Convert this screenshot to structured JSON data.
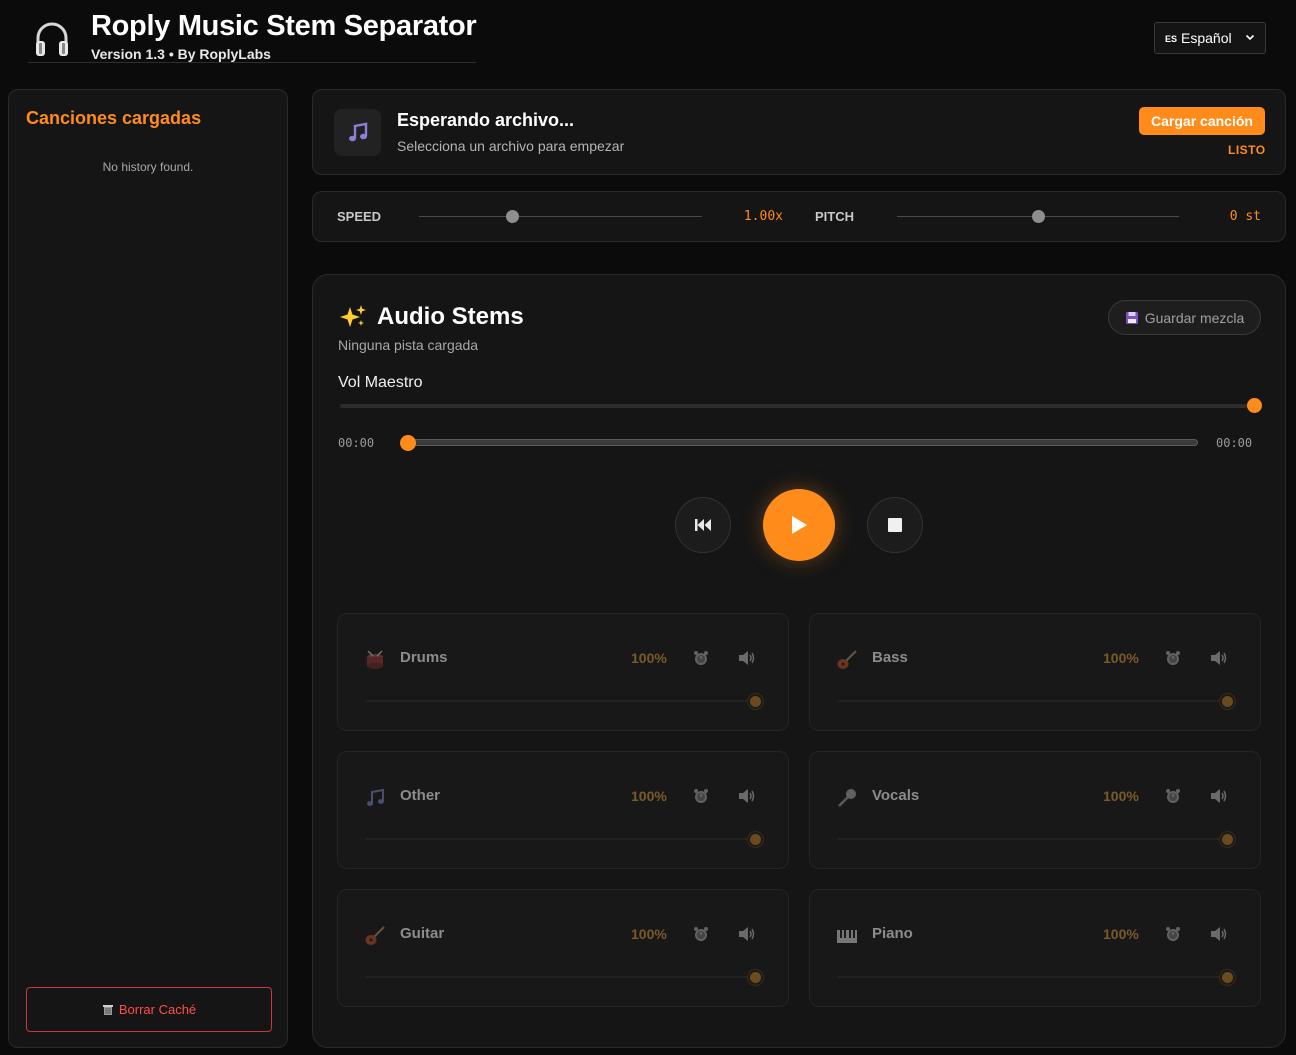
{
  "header": {
    "title": "Roply Music Stem Separator",
    "subtitle": "Version 1.3 • By RoplyLabs",
    "language": {
      "flag": "ES",
      "selected": "Español"
    }
  },
  "sidebar": {
    "title": "Canciones cargadas",
    "empty_text": "No history found.",
    "clear_cache_label": "Borrar Caché"
  },
  "loader": {
    "title": "Esperando archivo...",
    "subtitle": "Selecciona un archivo para empezar",
    "load_button": "Cargar canción",
    "status": "LISTO"
  },
  "controls": {
    "speed_label": "SPEED",
    "speed_value": "1.00x",
    "speed_level": 0.33,
    "pitch_label": "PITCH",
    "pitch_value": "0 st",
    "pitch_level": 0.5
  },
  "stems_panel": {
    "title": "Audio Stems",
    "subtitle": "Ninguna pista cargada",
    "save_mix_label": "Guardar mezcla",
    "master_volume_label": "Vol Maestro",
    "master_volume_level": 1.0,
    "time_current": "00:00",
    "time_total": "00:00",
    "seek_progress": 0
  },
  "stems": [
    {
      "name": "Drums",
      "percent": "100%",
      "icon": "drum-icon"
    },
    {
      "name": "Bass",
      "percent": "100%",
      "icon": "guitar-icon"
    },
    {
      "name": "Other",
      "percent": "100%",
      "icon": "notes-icon"
    },
    {
      "name": "Vocals",
      "percent": "100%",
      "icon": "microphone-icon"
    },
    {
      "name": "Guitar",
      "percent": "100%",
      "icon": "guitar-icon"
    },
    {
      "name": "Piano",
      "percent": "100%",
      "icon": "piano-icon"
    }
  ],
  "colors": {
    "accent": "#ff8c1a",
    "background": "#0b0b0b",
    "card": "#151515",
    "danger": "#ff4d4d"
  }
}
